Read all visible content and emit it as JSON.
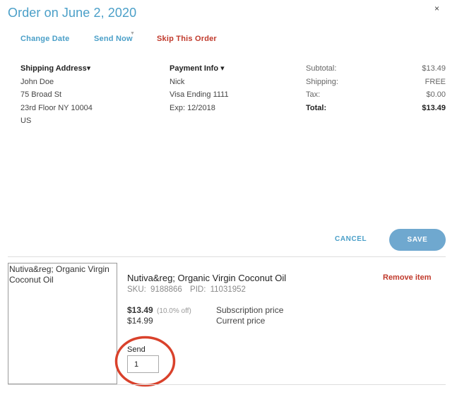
{
  "header": {
    "title": "Order on June 2, 2020",
    "close_symbol": "×"
  },
  "actions": {
    "change_date": "Change Date",
    "send_now": "Send Now",
    "skip_order": "Skip This Order"
  },
  "shipping": {
    "heading": "Shipping Address▾",
    "lines": [
      "John Doe",
      "75 Broad St",
      "23rd Floor NY 10004",
      "US"
    ]
  },
  "payment": {
    "heading": "Payment Info ▾",
    "lines": [
      "Nick",
      "Visa Ending 1111",
      "Exp: 12/2018"
    ]
  },
  "totals": {
    "subtotal_label": "Subtotal:",
    "subtotal_value": "$13.49",
    "shipping_label": "Shipping:",
    "shipping_value": "FREE",
    "tax_label": "Tax:",
    "tax_value": "$0.00",
    "total_label": "Total:",
    "total_value": "$13.49"
  },
  "buttons": {
    "cancel": "CANCEL",
    "save": "SAVE"
  },
  "item": {
    "image_alt": "Nutiva&reg; Organic Virgin Coconut Oil",
    "name": "Nutiva&reg; Organic Virgin Coconut Oil",
    "sku_label": "SKU:",
    "sku": "9188866",
    "pid_label": "PID:",
    "pid": "11031952",
    "remove_label": "Remove item",
    "subscription_price": "$13.49",
    "discount": "(10.0% off)",
    "subscription_label": "Subscription price",
    "current_price": "$14.99",
    "current_label": "Current price",
    "send_label": "Send",
    "send_value": "1"
  },
  "colors": {
    "accent": "#4a9fc8",
    "danger": "#c0392b",
    "save_button": "#6fa8cf",
    "annotation": "#d9412b"
  }
}
